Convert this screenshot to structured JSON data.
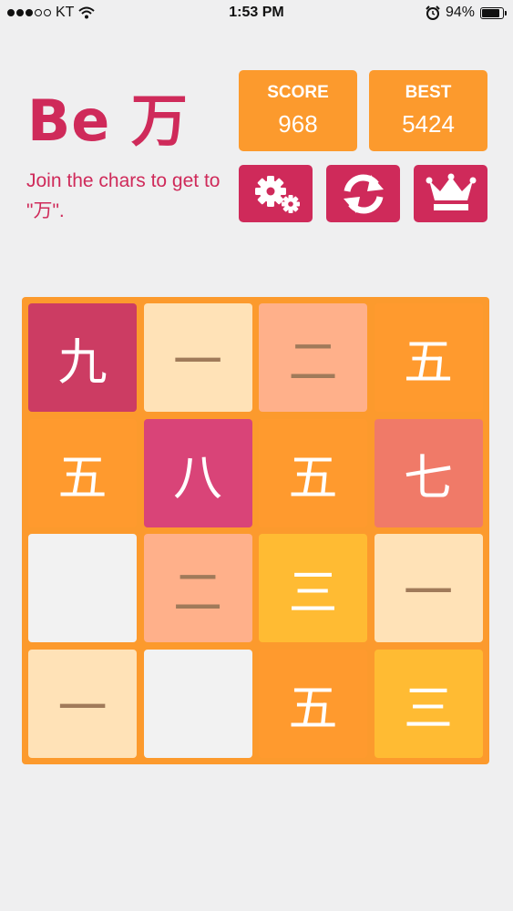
{
  "status_bar": {
    "carrier": "KT",
    "time": "1:53 PM",
    "battery": "94%",
    "battery_level": 0.94
  },
  "header": {
    "title": "Be 万",
    "subtitle": "Join the chars to get to \"万\"."
  },
  "scores": {
    "score_label": "SCORE",
    "score_value": "968",
    "best_label": "BEST",
    "best_value": "5424"
  },
  "toolbar": {
    "settings_icon": "gear-icon",
    "restart_icon": "refresh-icon",
    "leaderboard_icon": "crown-icon"
  },
  "colors": {
    "accent": "#cf2a5a",
    "board": "#fc9a2d",
    "score_box": "#fc9a2d",
    "background": "#efeff0"
  },
  "board": {
    "rows": [
      [
        "九",
        "一",
        "二",
        "五"
      ],
      [
        "五",
        "八",
        "五",
        "七"
      ],
      [
        "",
        "二",
        "三",
        "一"
      ],
      [
        "一",
        "",
        "五",
        "三"
      ]
    ]
  }
}
